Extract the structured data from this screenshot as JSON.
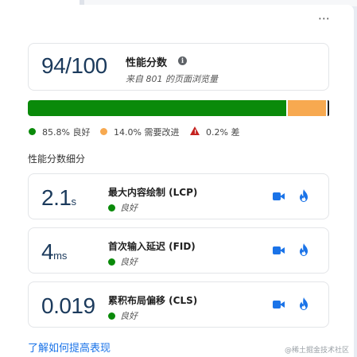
{
  "menu": {
    "more_label": "⋯"
  },
  "score": {
    "value": "94/100",
    "title": "性能分数",
    "info_label": "i",
    "subtitle": "来自 801 的页面浏览量"
  },
  "distribution": {
    "good_fraction": 0.858,
    "improve_fraction": 0.14,
    "poor_fraction": 0.002,
    "colors": {
      "good": "#0a8a0a",
      "improve": "#f7a950",
      "poor": "#c5221f"
    },
    "legend": [
      {
        "label": "85.8% 良好",
        "icon": "green-dot-icon"
      },
      {
        "label": "14.0% 需要改进",
        "icon": "orange-dot-icon"
      },
      {
        "label": "0.2% 差",
        "icon": "warning-triangle-icon"
      }
    ]
  },
  "breakdown": {
    "title": "性能分数细分",
    "metrics": [
      {
        "value": "2.1",
        "unit": "s",
        "name": "最大内容绘制 (LCP)",
        "status": "良好"
      },
      {
        "value": "4",
        "unit": "ms",
        "name": "首次输入延迟 (FID)",
        "status": "良好"
      },
      {
        "value": "0.019",
        "unit": "",
        "name": "累积布局偏移 (CLS)",
        "status": "良好"
      }
    ]
  },
  "footer": {
    "improve_link": "了解如何提高表现",
    "watermark": "@稀土掘金技术社区"
  }
}
